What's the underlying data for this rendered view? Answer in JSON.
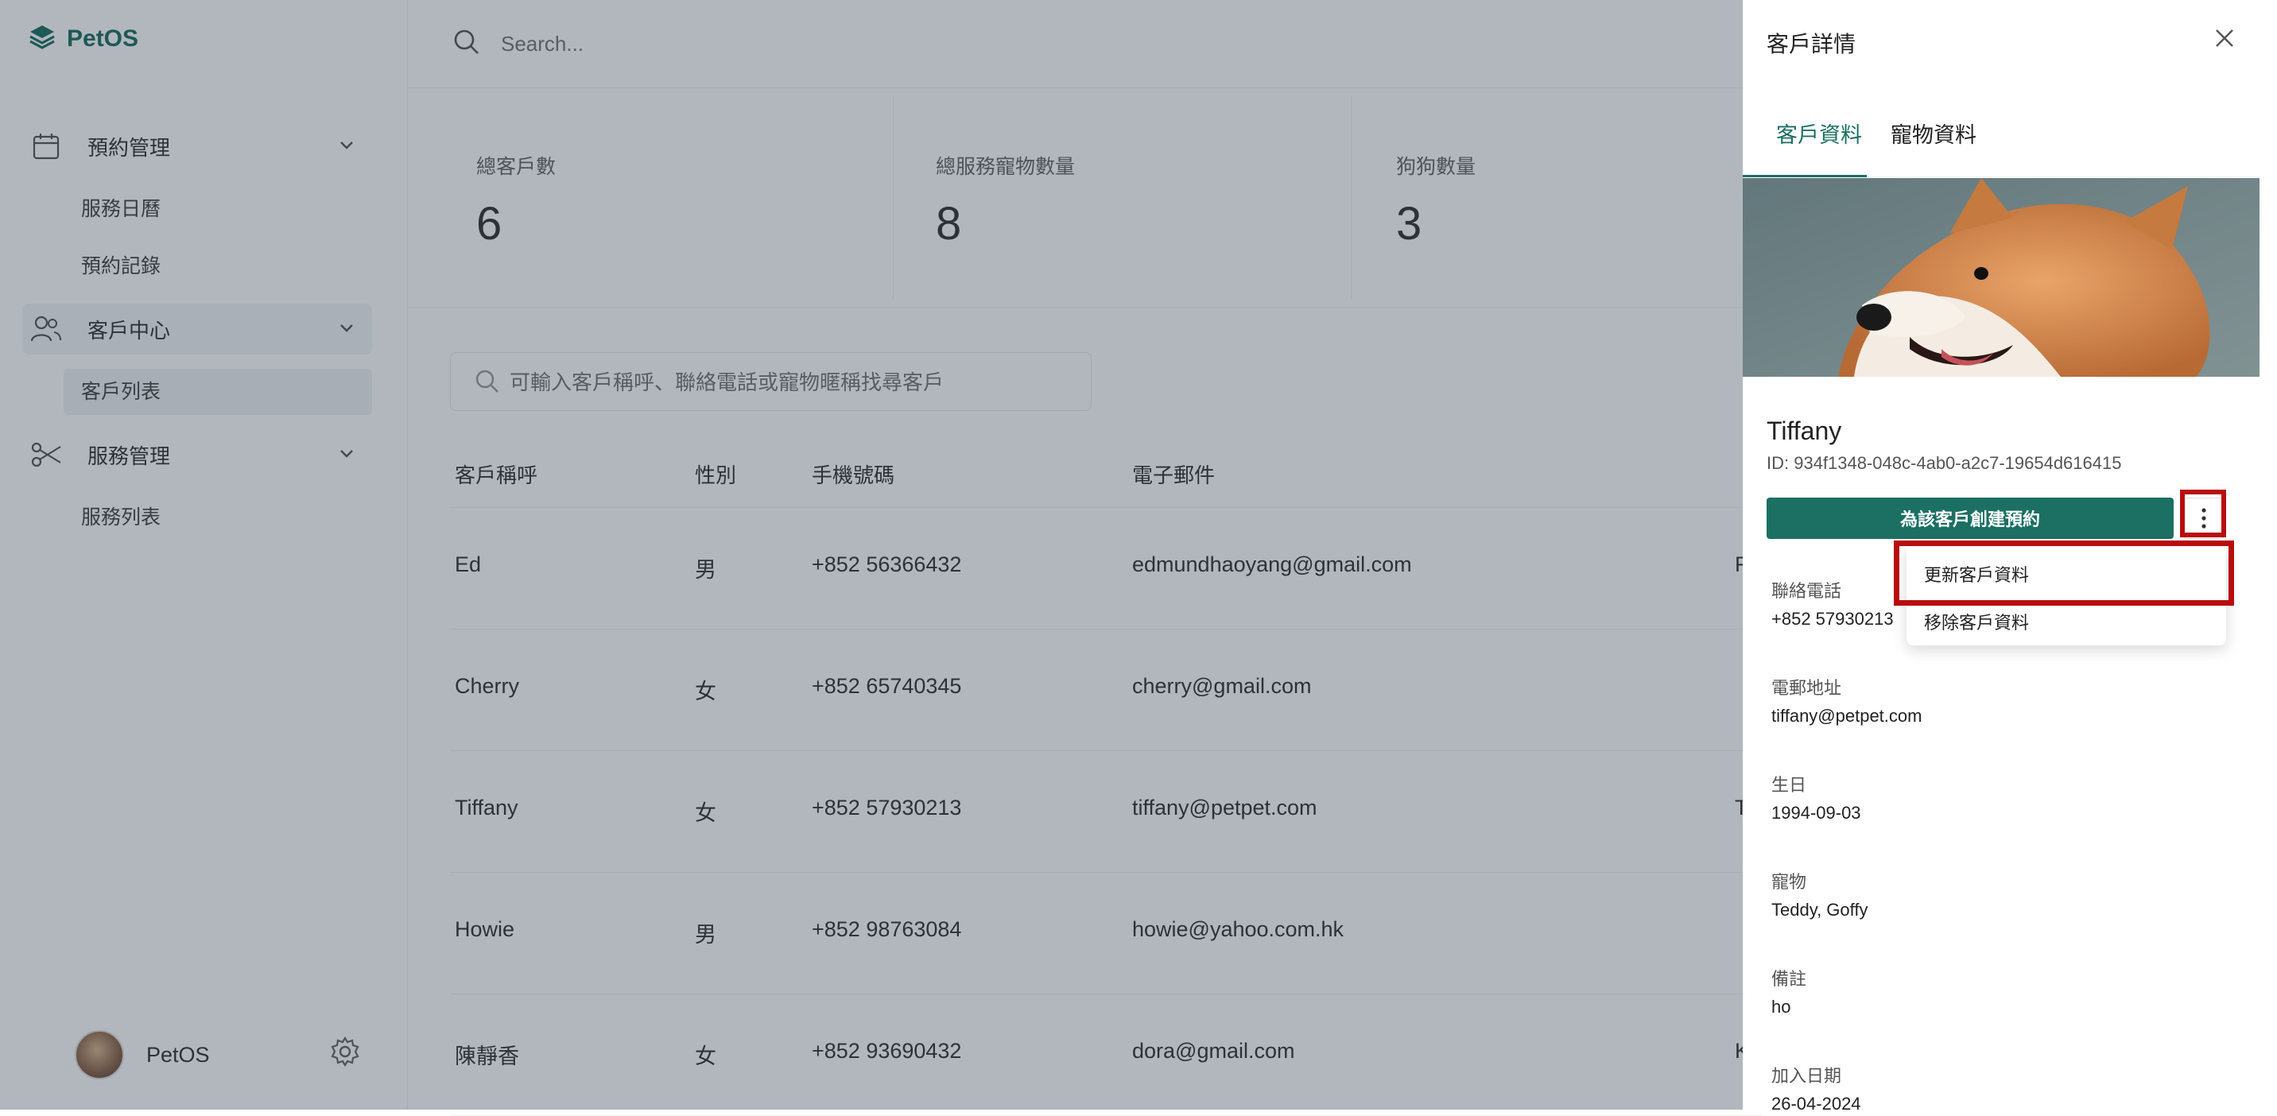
{
  "brand": {
    "name": "PetOS"
  },
  "sidebar": {
    "groups": [
      {
        "label": "預約管理",
        "items": [
          "服務日曆",
          "預約記錄"
        ]
      },
      {
        "label": "客戶中心",
        "items": [
          "客戶列表"
        ]
      },
      {
        "label": "服務管理",
        "items": [
          "服務列表"
        ]
      }
    ],
    "user": {
      "name": "PetOS"
    }
  },
  "topbar": {
    "search_placeholder": "Search..."
  },
  "stats": [
    {
      "label": "總客戶數",
      "value": "6"
    },
    {
      "label": "總服務寵物數量",
      "value": "8"
    },
    {
      "label": "狗狗數量",
      "value": "3"
    }
  ],
  "customer_search": {
    "placeholder": "可輸入客戶稱呼、聯絡電話或寵物暱稱找尋客戶"
  },
  "table": {
    "headers": [
      "客戶稱呼",
      "性別",
      "手機號碼",
      "電子郵件"
    ],
    "rows": [
      {
        "name": "Ed",
        "gender": "男",
        "phone": "+852 56366432",
        "email": "edmundhaoyang@gmail.com",
        "extra": "F"
      },
      {
        "name": "Cherry",
        "gender": "女",
        "phone": "+852 65740345",
        "email": "cherry@gmail.com",
        "extra": ""
      },
      {
        "name": "Tiffany",
        "gender": "女",
        "phone": "+852 57930213",
        "email": "tiffany@petpet.com",
        "extra": "T"
      },
      {
        "name": "Howie",
        "gender": "男",
        "phone": "+852 98763084",
        "email": "howie@yahoo.com.hk",
        "extra": ""
      },
      {
        "name": "陳靜香",
        "gender": "女",
        "phone": "+852 93690432",
        "email": "dora@gmail.com",
        "extra": "K"
      }
    ]
  },
  "drawer": {
    "title": "客戶詳情",
    "tabs": [
      "客戶資料",
      "寵物資料"
    ],
    "customer": {
      "name": "Tiffany",
      "id": "ID: 934f1348-048c-4ab0-a2c7-19654d616415"
    },
    "create_booking_label": "為該客戶創建預約",
    "menu": [
      "更新客戶資料",
      "移除客戶資料"
    ],
    "fields": [
      {
        "label": "聯絡電話",
        "value": "+852 57930213"
      },
      {
        "label": "電郵地址",
        "value": "tiffany@petpet.com"
      },
      {
        "label": "生日",
        "value": "1994-09-03"
      },
      {
        "label": "寵物",
        "value": "Teddy, Goffy"
      },
      {
        "label": "備註",
        "value": "ho"
      },
      {
        "label": "加入日期",
        "value": "26-04-2024"
      }
    ]
  },
  "colors": {
    "brand": "#1b6f63",
    "highlight": "#b80d0d",
    "overlay": "rgba(35,48,66,0.35)"
  }
}
